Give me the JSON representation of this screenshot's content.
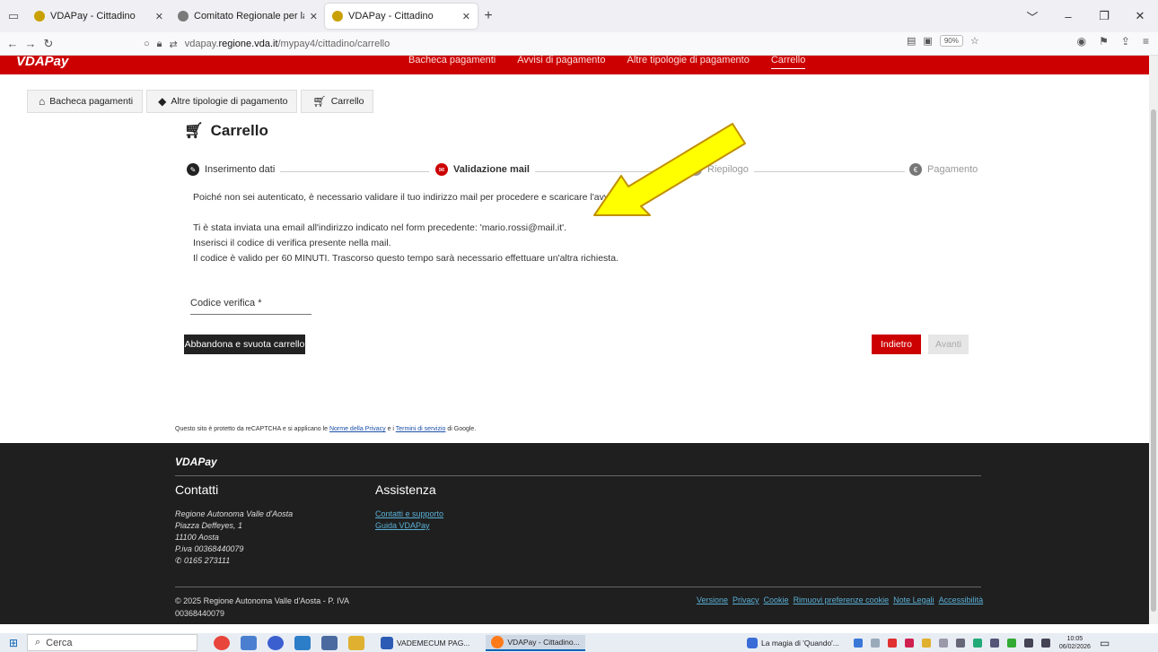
{
  "browser": {
    "tabs": [
      {
        "title": "VDAPay - Cittadino",
        "favicon_color": "#c8a000"
      },
      {
        "title": "Comitato Regionale per la Gesti",
        "favicon_color": "#7a7a7a"
      },
      {
        "title": "VDAPay - Cittadino",
        "favicon_color": "#c8a000"
      }
    ],
    "url_domain_prefix": "vdapay.",
    "url_domain": "regione.vda.it",
    "url_path": "/mypay4/cittadino/carrello",
    "zoom": "90%"
  },
  "topbar": {
    "logo": "VDAPay",
    "nav": [
      "Bacheca pagamenti",
      "Avvisi di pagamento",
      "Altre tipologie di pagamento",
      "Carrello"
    ]
  },
  "breadcrumb": [
    {
      "label": "Bacheca pagamenti",
      "icon": "home-icon"
    },
    {
      "label": "Altre tipologie di pagamento",
      "icon": "tags-icon"
    },
    {
      "label": "Carrello",
      "icon": "cart-icon"
    }
  ],
  "page": {
    "title": "Carrello",
    "steps": [
      {
        "label": "Inserimento dati",
        "icon": "pencil-icon",
        "color": "#222222"
      },
      {
        "label": "Validazione mail",
        "icon": "mail-icon",
        "color": "#c00000"
      },
      {
        "label": "Riepilogo",
        "icon": "list-icon",
        "color": "#999999"
      },
      {
        "label": "Pagamento",
        "icon": "euro-icon",
        "color": "#999999"
      }
    ],
    "messages": [
      "Poiché non sei autenticato, è necessario validare il tuo indirizzo mail per procedere e scaricare l'avviso.",
      "Ti è stata inviata una email all'indirizzo indicato nel form precedente: 'mario.rossi@mail.it'.",
      "Inserisci il codice di verifica presente nella mail.",
      "Il codice è valido per 60 MINUTI. Trascorso questo tempo sarà necessario effettuare un'altra richiesta."
    ],
    "field_label": "Codice verifica *",
    "buttons": {
      "abandon": "Abbandona e svuota carrello",
      "back": "Indietro",
      "next": "Avanti"
    },
    "recaptcha": {
      "prefix": "Questo sito è protetto da reCAPTCHA e si applicano le ",
      "privacy": "Norme della Privacy",
      "mid": " e i ",
      "terms": "Termini di servizio",
      "suffix": " di Google."
    }
  },
  "footer": {
    "logo": "VDAPay",
    "contacts_title": "Contatti",
    "assist_title": "Assistenza",
    "address": [
      "Regione Autonoma Valle d'Aosta",
      "Piazza Deffeyes, 1",
      "11100 Aosta",
      "P.iva 00368440079"
    ],
    "phone": "0165 273111",
    "assist_links": [
      "Contatti e supporto",
      "Guida VDAPay"
    ],
    "copyright": "© 2025 Regione Autonoma Valle d'Aosta - P. IVA 00368440079",
    "bottom_links": [
      "Versione",
      "Privacy",
      "Cookie",
      "Rimuovi preferenze cookie",
      "Note Legali",
      "Accessibilità"
    ]
  },
  "taskbar": {
    "search": "Cerca",
    "tasks": [
      "VADEMECUM PAG...",
      "VDAPay - Cittadino..."
    ],
    "media": "La magia di 'Quando'...",
    "time": "10:05",
    "date": "06/02/2026"
  },
  "colors": {
    "brand_red": "#cc0000",
    "arrow_fill": "#ffff00",
    "arrow_stroke": "#c09000"
  }
}
